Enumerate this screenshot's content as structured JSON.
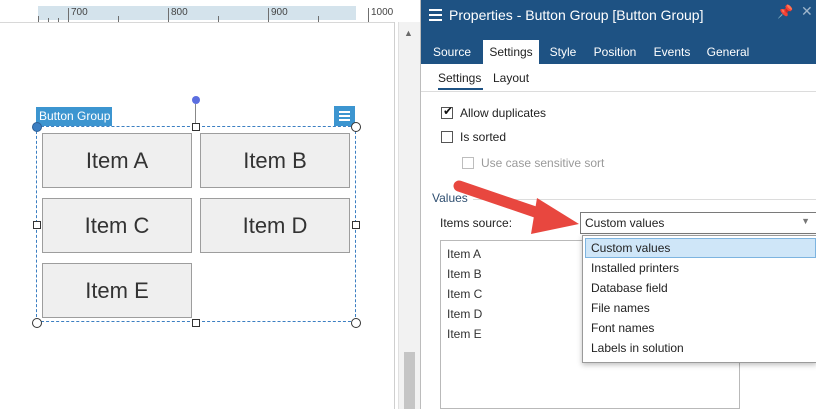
{
  "ruler": {
    "labels": [
      "700",
      "800",
      "900",
      "1000"
    ]
  },
  "designer": {
    "group_label": "Button Group",
    "buttons": [
      "Item A",
      "Item B",
      "Item C",
      "Item D",
      "Item E"
    ]
  },
  "panel": {
    "title": "Properties - Button Group [Button Group]",
    "tabs": [
      "Source",
      "Settings",
      "Style",
      "Position",
      "Events",
      "General"
    ],
    "active_tab": "Settings",
    "subtabs": [
      "Settings",
      "Layout"
    ],
    "active_subtab": "Settings",
    "allow_duplicates_label": "Allow duplicates",
    "allow_duplicates_checked": true,
    "is_sorted_label": "Is sorted",
    "is_sorted_checked": false,
    "case_sensitive_label": "Use case sensitive sort",
    "values_section": "Values",
    "items_source_label": "Items source:",
    "items_source_value": "Custom values",
    "items": [
      "Item A",
      "Item B",
      "Item C",
      "Item D",
      "Item E"
    ],
    "dropdown_options": [
      "Custom values",
      "Installed printers",
      "Database field",
      "File names",
      "Font names",
      "Labels in solution"
    ],
    "selected_option": "Custom values"
  },
  "colors": {
    "titlebar": "#1e5283",
    "selection_blue": "#3c95d0",
    "callout_arrow": "#e8473f"
  }
}
